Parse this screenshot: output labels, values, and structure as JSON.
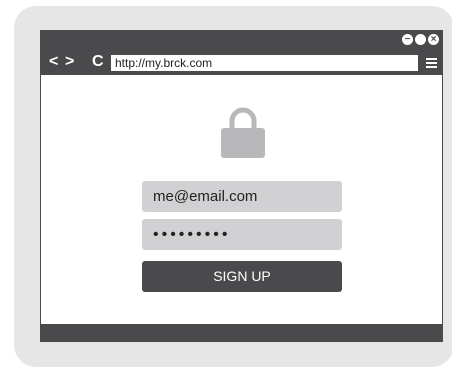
{
  "browser": {
    "url": "http://my.brck.com",
    "back_glyph": "<",
    "forward_glyph": ">",
    "reload_glyph": "C",
    "window_buttons": [
      "minimize",
      "maximize",
      "close"
    ]
  },
  "login": {
    "email_value": "me@email.com",
    "password_value": "•••••••••",
    "signup_label": "SIGN UP"
  },
  "icons": {
    "lock": "lock-icon",
    "menu": "hamburger-menu-icon"
  },
  "colors": {
    "frame_dark": "#4a4a4c",
    "card_bg": "#e6e6e7",
    "input_bg": "#d1d1d3",
    "lock_gray": "#b8b8ba"
  }
}
